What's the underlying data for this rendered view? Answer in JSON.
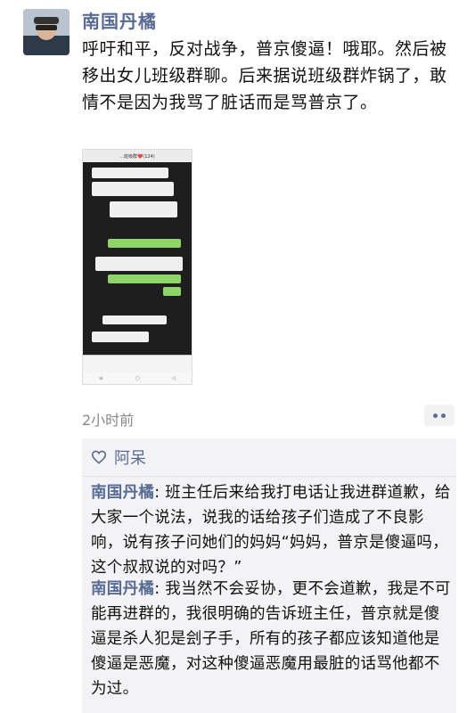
{
  "post": {
    "author": "南国丹橘",
    "text": "呼吁和平，反对战争，普京傻逼！哦耶。然后被移出女儿班级群聊。后来据说班级群炸锅了，敢情不是因为我骂了脏话而是骂普京了。",
    "time": "2小时前"
  },
  "screenshot": {
    "title": "...班级群❤️(124)"
  },
  "likes": {
    "names": "阿呆"
  },
  "comments": [
    {
      "author": "南国丹橘",
      "text": "班主任后来给我打电话让我进群道歉，给大家一个说法，说我的话给孩子们造成了不良影响，说有孩子问她们的妈妈“妈妈，普京是傻逼吗，这个叔叔说的对吗？”"
    },
    {
      "author": "南国丹橘",
      "text": "我当然不会妥协，更不会道歉，我是不可能再进群的，我很明确的告诉班主任，普京就是傻逼是杀人犯是刽子手，所有的孩子都应该知道他是傻逼是恶魔，对这种傻逼恶魔用最脏的话骂他都不为过。"
    }
  ]
}
